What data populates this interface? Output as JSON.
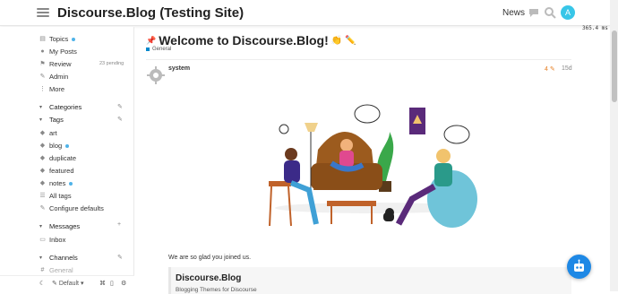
{
  "header": {
    "site_title": "Discourse.Blog (Testing Site)",
    "nav_news": "News",
    "avatar_letter": "A"
  },
  "timing": "365.4 ms",
  "sidebar": {
    "top_items": [
      {
        "label": "Topics",
        "icon": "topics-icon",
        "dot": true
      },
      {
        "label": "My Posts",
        "icon": "user-icon"
      },
      {
        "label": "Review",
        "icon": "flag-icon",
        "badge": "23 pending"
      },
      {
        "label": "Admin",
        "icon": "wrench-icon"
      },
      {
        "label": "More",
        "icon": "more-icon"
      }
    ],
    "categories_label": "Categories",
    "tags_label": "Tags",
    "tags": [
      {
        "label": "art"
      },
      {
        "label": "blog",
        "dot": true
      },
      {
        "label": "duplicate"
      },
      {
        "label": "featured"
      },
      {
        "label": "notes",
        "dot": true
      }
    ],
    "all_tags": "All tags",
    "configure_defaults": "Configure defaults",
    "messages_label": "Messages",
    "inbox": "Inbox",
    "channels_label": "Channels",
    "channel_partial": "General",
    "footer_theme": "Default"
  },
  "topic": {
    "title": "Welcome to Discourse.Blog!",
    "title_emojis": "👏 ✏️",
    "category": "General",
    "username": "system",
    "likes": "4",
    "age": "15d",
    "intro": "We are so glad you joined us.",
    "quote_title": "Discourse.Blog",
    "quote_sub": "Blogging Themes for Discourse"
  },
  "colors": {
    "accent": "#1e88e5",
    "avatar_bg": "#38c6e8",
    "dot": "#4fb3e8",
    "category": "#0088cc",
    "like": "#e67e22"
  }
}
